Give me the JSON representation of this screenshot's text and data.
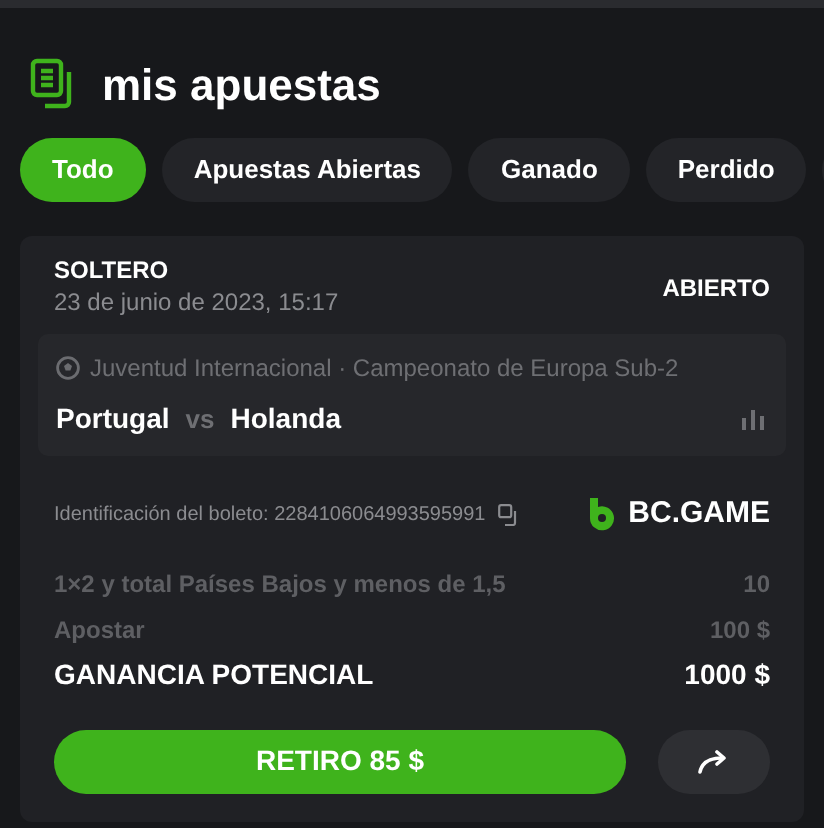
{
  "header": {
    "title": "mis apuestas"
  },
  "tabs": [
    {
      "label": "Todo",
      "selected": true
    },
    {
      "label": "Apuestas Abiertas",
      "selected": false
    },
    {
      "label": "Ganado",
      "selected": false
    },
    {
      "label": "Perdido",
      "selected": false
    }
  ],
  "bet": {
    "type": "SOLTERO",
    "date": "23 de junio de 2023, 15:17",
    "status": "ABIERTO",
    "event": {
      "competition": "Juventud Internacional · Campeonato de Europa Sub-2",
      "home": "Portugal",
      "vs": "vs",
      "away": "Holanda"
    },
    "ticket": "Identificación del boleto: 2284106064993595991",
    "brand": "BC.GAME",
    "rows": [
      {
        "label": "1×2 y total Países Bajos y menos de 1,5",
        "value": "10",
        "kind": "muted"
      },
      {
        "label": "Apostar",
        "value": "100 $",
        "kind": "muted"
      },
      {
        "label": "GANANCIA POTENCIAL",
        "value": "1000 $",
        "kind": "strong"
      }
    ],
    "cashout": "RETIRO 85 $"
  }
}
